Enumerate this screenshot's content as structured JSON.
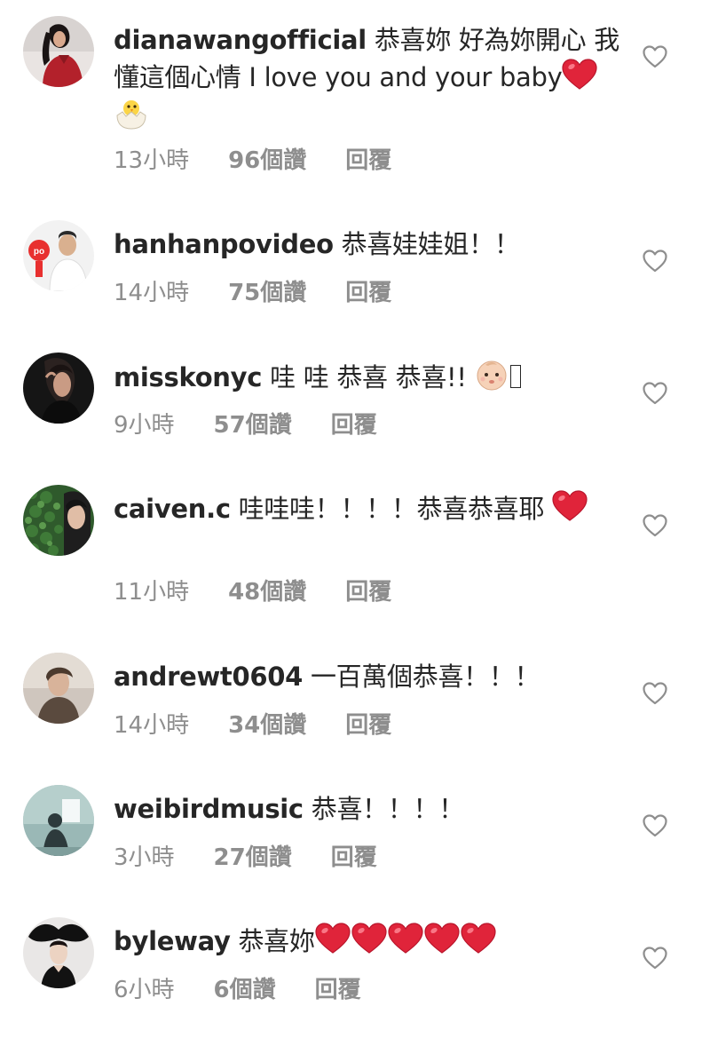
{
  "comments": [
    {
      "username": "dianawangofficial",
      "text": "恭喜妳 好為妳開心 我懂這個心情 I love you and your baby",
      "time": "13小時",
      "likes": "96個讚",
      "reply": "回覆"
    },
    {
      "username": "hanhanpovideo",
      "text": "恭喜娃娃姐！！",
      "time": "14小時",
      "likes": "75個讚",
      "reply": "回覆"
    },
    {
      "username": "misskonyc",
      "text": "哇 哇 恭喜 恭喜!!",
      "time": "9小時",
      "likes": "57個讚",
      "reply": "回覆"
    },
    {
      "username": "caiven.c",
      "text": "哇哇哇！！！！恭喜恭喜耶",
      "time": "11小時",
      "likes": "48個讚",
      "reply": "回覆"
    },
    {
      "username": "andrewt0604",
      "text": "一百萬個恭喜！！！",
      "time": "14小時",
      "likes": "34個讚",
      "reply": "回覆"
    },
    {
      "username": "weibirdmusic",
      "text": "恭喜！！！！",
      "time": "3小時",
      "likes": "27個讚",
      "reply": "回覆"
    },
    {
      "username": "byleway",
      "text": "恭喜妳",
      "time": "6小時",
      "likes": "6個讚",
      "reply": "回覆"
    }
  ],
  "avatar_badge": "po",
  "colors": {
    "username": "#262626",
    "meta": "#8e8e8e",
    "heart_emoji": "#e0243a",
    "like_icon": "#8e8e8e"
  }
}
